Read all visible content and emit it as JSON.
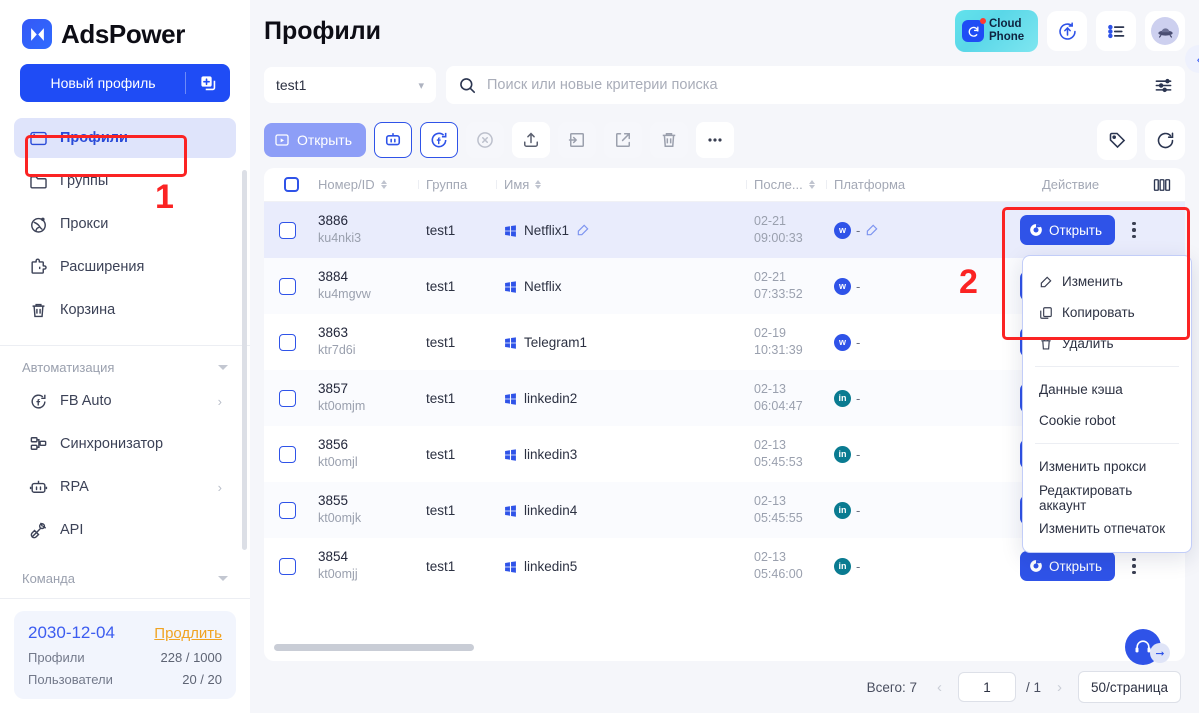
{
  "brand": {
    "name": "AdsPower",
    "logo_icon": "adspower-logo-icon"
  },
  "sidebar": {
    "new_profile_label": "Новый профиль",
    "add_icon": "add-profile-icon",
    "collapse_icon": "chevron-left-icon",
    "items": [
      {
        "label": "Профили",
        "icon": "profiles-icon",
        "active": true
      },
      {
        "label": "Группы",
        "icon": "folder-icon",
        "active": false
      },
      {
        "label": "Прокси",
        "icon": "proxy-globe-icon",
        "active": false
      },
      {
        "label": "Расширения",
        "icon": "puzzle-icon",
        "active": false
      },
      {
        "label": "Корзина",
        "icon": "trash-icon",
        "active": false
      }
    ],
    "automation_section": "Автоматизация",
    "automation_items": [
      {
        "label": "FB Auto",
        "icon": "facebook-auto-icon",
        "chevron": true
      },
      {
        "label": "Синхронизатор",
        "icon": "synchronizer-icon",
        "chevron": false
      },
      {
        "label": "RPA",
        "icon": "rpa-robot-icon",
        "chevron": true
      },
      {
        "label": "API",
        "icon": "api-plug-icon",
        "chevron": false
      }
    ],
    "team_section": "Команда",
    "license": {
      "date": "2030-12-04",
      "renew_label": "Продлить",
      "rows": [
        {
          "label": "Профили",
          "value": "228 / 1000"
        },
        {
          "label": "Пользователи",
          "value": "20 / 20"
        }
      ]
    }
  },
  "header": {
    "title": "Профили",
    "cloud_phone_line1": "Cloud",
    "cloud_phone_line2": "Phone",
    "icons": [
      {
        "name": "sync-update-icon"
      },
      {
        "name": "task-list-icon"
      },
      {
        "name": "ufo-avatar-icon"
      }
    ]
  },
  "search": {
    "group_value": "test1",
    "placeholder": "Поиск или новые критерии поиска",
    "search_icon": "search-icon",
    "filter_icon": "filter-sliders-icon",
    "caret_icon": "chevron-down-icon"
  },
  "toolbar": {
    "open_label": "Открыть",
    "open_icon": "play-window-icon",
    "buttons": [
      {
        "name": "rpa-robot-button",
        "icon": "robot-icon",
        "style": "outlined"
      },
      {
        "name": "fb-sync-button",
        "icon": "facebook-sync-icon",
        "style": "outlined"
      },
      {
        "name": "close-button",
        "icon": "circle-x-icon",
        "style": "ghost"
      },
      {
        "name": "upload-button",
        "icon": "upload-icon",
        "style": "plain"
      },
      {
        "name": "move-to-group-button",
        "icon": "move-folder-icon",
        "style": "ghost"
      },
      {
        "name": "export-button",
        "icon": "share-export-icon",
        "style": "ghost"
      },
      {
        "name": "delete-button",
        "icon": "trash-icon",
        "style": "ghost"
      },
      {
        "name": "more-button",
        "icon": "ellipsis-icon",
        "style": "plain"
      }
    ],
    "right_buttons": [
      {
        "name": "tag-button",
        "icon": "tag-icon"
      },
      {
        "name": "refresh-button",
        "icon": "refresh-icon"
      }
    ]
  },
  "table": {
    "columns": [
      {
        "key": "check",
        "label": "",
        "sortable": false
      },
      {
        "key": "id",
        "label": "Номер/ID",
        "sortable": true
      },
      {
        "key": "group",
        "label": "Группа",
        "sortable": false
      },
      {
        "key": "name",
        "label": "Имя",
        "sortable": true
      },
      {
        "key": "last",
        "label": "После...",
        "sortable": true
      },
      {
        "key": "platform",
        "label": "Платформа",
        "sortable": false
      },
      {
        "key": "action",
        "label": "Действие",
        "sortable": false
      }
    ],
    "columns_icon": "column-settings-icon",
    "row_open_label": "Открыть",
    "row_open_icon": "chrome-open-icon",
    "rows": [
      {
        "id": "3886",
        "sub": "ku4nki3",
        "group": "test1",
        "name": "Netflix1",
        "name_edit_icon": "edit-icon",
        "date": "02-21",
        "time": "09:00:33",
        "platform": "w",
        "platform_dash": "-",
        "platform_edit_icon": "edit-icon",
        "selected": true
      },
      {
        "id": "3884",
        "sub": "ku4mgvw",
        "group": "test1",
        "name": "Netflix",
        "name_edit_icon": "",
        "date": "02-21",
        "time": "07:33:52",
        "platform": "w",
        "platform_dash": "-",
        "platform_edit_icon": "",
        "selected": false
      },
      {
        "id": "3863",
        "sub": "ktr7d6i",
        "group": "test1",
        "name": "Telegram1",
        "name_edit_icon": "",
        "date": "02-19",
        "time": "10:31:39",
        "platform": "w",
        "platform_dash": "-",
        "platform_edit_icon": "",
        "selected": false
      },
      {
        "id": "3857",
        "sub": "kt0omjm",
        "group": "test1",
        "name": "linkedin2",
        "name_edit_icon": "",
        "date": "02-13",
        "time": "06:04:47",
        "platform": "in",
        "platform_dash": "-",
        "platform_edit_icon": "",
        "selected": false
      },
      {
        "id": "3856",
        "sub": "kt0omjl",
        "group": "test1",
        "name": "linkedin3",
        "name_edit_icon": "",
        "date": "02-13",
        "time": "05:45:53",
        "platform": "in",
        "platform_dash": "-",
        "platform_edit_icon": "",
        "selected": false
      },
      {
        "id": "3855",
        "sub": "kt0omjk",
        "group": "test1",
        "name": "linkedin4",
        "name_edit_icon": "",
        "date": "02-13",
        "time": "05:45:55",
        "platform": "in",
        "platform_dash": "-",
        "platform_edit_icon": "",
        "selected": false
      },
      {
        "id": "3854",
        "sub": "kt0omjj",
        "group": "test1",
        "name": "linkedin5",
        "name_edit_icon": "",
        "date": "02-13",
        "time": "05:46:00",
        "platform": "in",
        "platform_dash": "-",
        "platform_edit_icon": "",
        "selected": false
      }
    ]
  },
  "context_menu": {
    "items": [
      {
        "label": "Изменить",
        "icon": "edit-icon",
        "group": 1
      },
      {
        "label": "Копировать",
        "icon": "copy-icon",
        "group": 1
      },
      {
        "label": "Удалить",
        "icon": "trash-icon",
        "group": 1
      },
      {
        "label": "Данные кэша",
        "icon": "",
        "group": 2
      },
      {
        "label": "Cookie robot",
        "icon": "",
        "group": 2
      },
      {
        "label": "Изменить прокси",
        "icon": "",
        "group": 3
      },
      {
        "label": "Редактировать аккаунт",
        "icon": "",
        "group": 3
      },
      {
        "label": "Изменить отпечаток",
        "icon": "",
        "group": 3
      }
    ]
  },
  "footer": {
    "total_label": "Всего: 7",
    "page_value": "1",
    "page_of": "/ 1",
    "page_size": "50/страница",
    "prev_icon": "chevron-left-icon",
    "next_icon": "chevron-right-icon"
  },
  "annotations": [
    {
      "number": "1"
    },
    {
      "number": "2"
    }
  ],
  "support": {
    "icon": "headset-icon",
    "arrow_icon": "arrow-right-icon"
  },
  "colors": {
    "accent": "#2f53e8",
    "annotation": "#fb2323",
    "selected_row": "#e9ecfc"
  }
}
